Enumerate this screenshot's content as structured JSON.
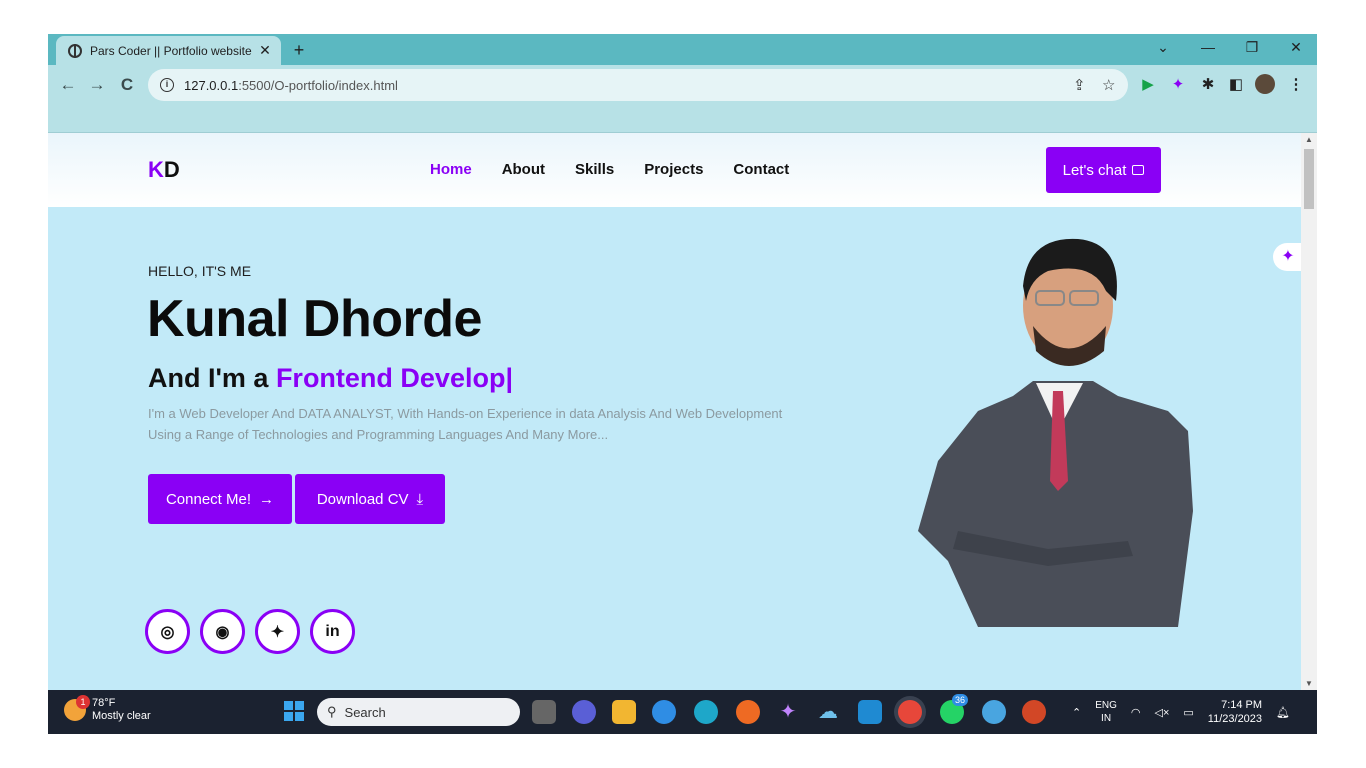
{
  "browser": {
    "tab_title": "Pars Coder || Portfolio website",
    "tab_close": "✕",
    "new_tab": "+",
    "url_host": "127.0.0.1",
    "url_rest": ":5500/O-portfolio/index.html",
    "window_minimize": "—",
    "window_restore": "❐",
    "window_close": "✕",
    "window_dropdown": "⌄"
  },
  "site": {
    "logo_k": "K",
    "logo_d": "D",
    "nav": [
      {
        "label": "Home",
        "active": true
      },
      {
        "label": "About"
      },
      {
        "label": "Skills"
      },
      {
        "label": "Projects"
      },
      {
        "label": "Contact"
      }
    ],
    "chat_label": "Let's chat"
  },
  "hero": {
    "greeting": "HELLO, IT'S ME",
    "name": "Kunal Dhorde",
    "role_prefix": "And I'm a ",
    "role_typed": "Frontend Develop|",
    "intro": "I'm a Web Developer And DATA ANALYST, With Hands-on Experience in data Analysis And Web Development Using a Range of Technologies and Programming Languages And Many More...",
    "btn_connect": "Connect Me!",
    "btn_connect_icon": "→",
    "btn_download": "Download CV",
    "btn_download_icon": "⤓",
    "social": [
      {
        "name": "instagram",
        "glyph": "◎"
      },
      {
        "name": "github",
        "glyph": "◉"
      },
      {
        "name": "twitter",
        "glyph": "✦"
      },
      {
        "name": "linkedin",
        "glyph": "in"
      }
    ]
  },
  "taskbar": {
    "weather_temp": "78°F",
    "weather_desc": "Mostly clear",
    "weather_badge": "1",
    "search_placeholder": "Search",
    "whatsapp_badge": "36",
    "lang_top": "ENG",
    "lang_bottom": "IN",
    "time": "7:14 PM",
    "date": "11/23/2023"
  },
  "colors": {
    "accent": "#8a00f5",
    "hero_bg": "#c2eaf8",
    "chrome_bg": "#b7e1e6",
    "taskbar_bg": "#1b2230"
  }
}
